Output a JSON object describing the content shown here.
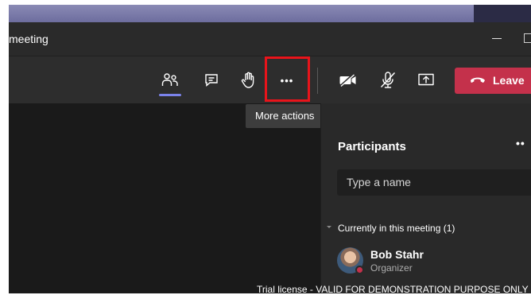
{
  "window": {
    "title": "meeting",
    "minimize_glyph": "—"
  },
  "toolbar": {
    "people_icon": "people-icon",
    "chat_icon": "chat-icon",
    "raise_hand_icon": "raise-hand-icon",
    "more_actions_label": "•••",
    "camera_icon": "camera-off-icon",
    "mic_icon": "mic-off-icon",
    "share_icon": "share-screen-icon",
    "leave_label": "Leave",
    "leave_color": "#c4314b",
    "accent": "#7b83eb",
    "highlight_color": "#e8141b"
  },
  "tooltip": {
    "text": "More actions"
  },
  "participants": {
    "title": "Participants",
    "more_label": "••",
    "search_placeholder": "Type a name",
    "section_label": "Currently in this meeting (1)",
    "people": [
      {
        "name": "Bob Stahr",
        "role": "Organizer"
      }
    ]
  },
  "watermark": "Trial license - VALID FOR DEMONSTRATION PURPOSE ONLY"
}
